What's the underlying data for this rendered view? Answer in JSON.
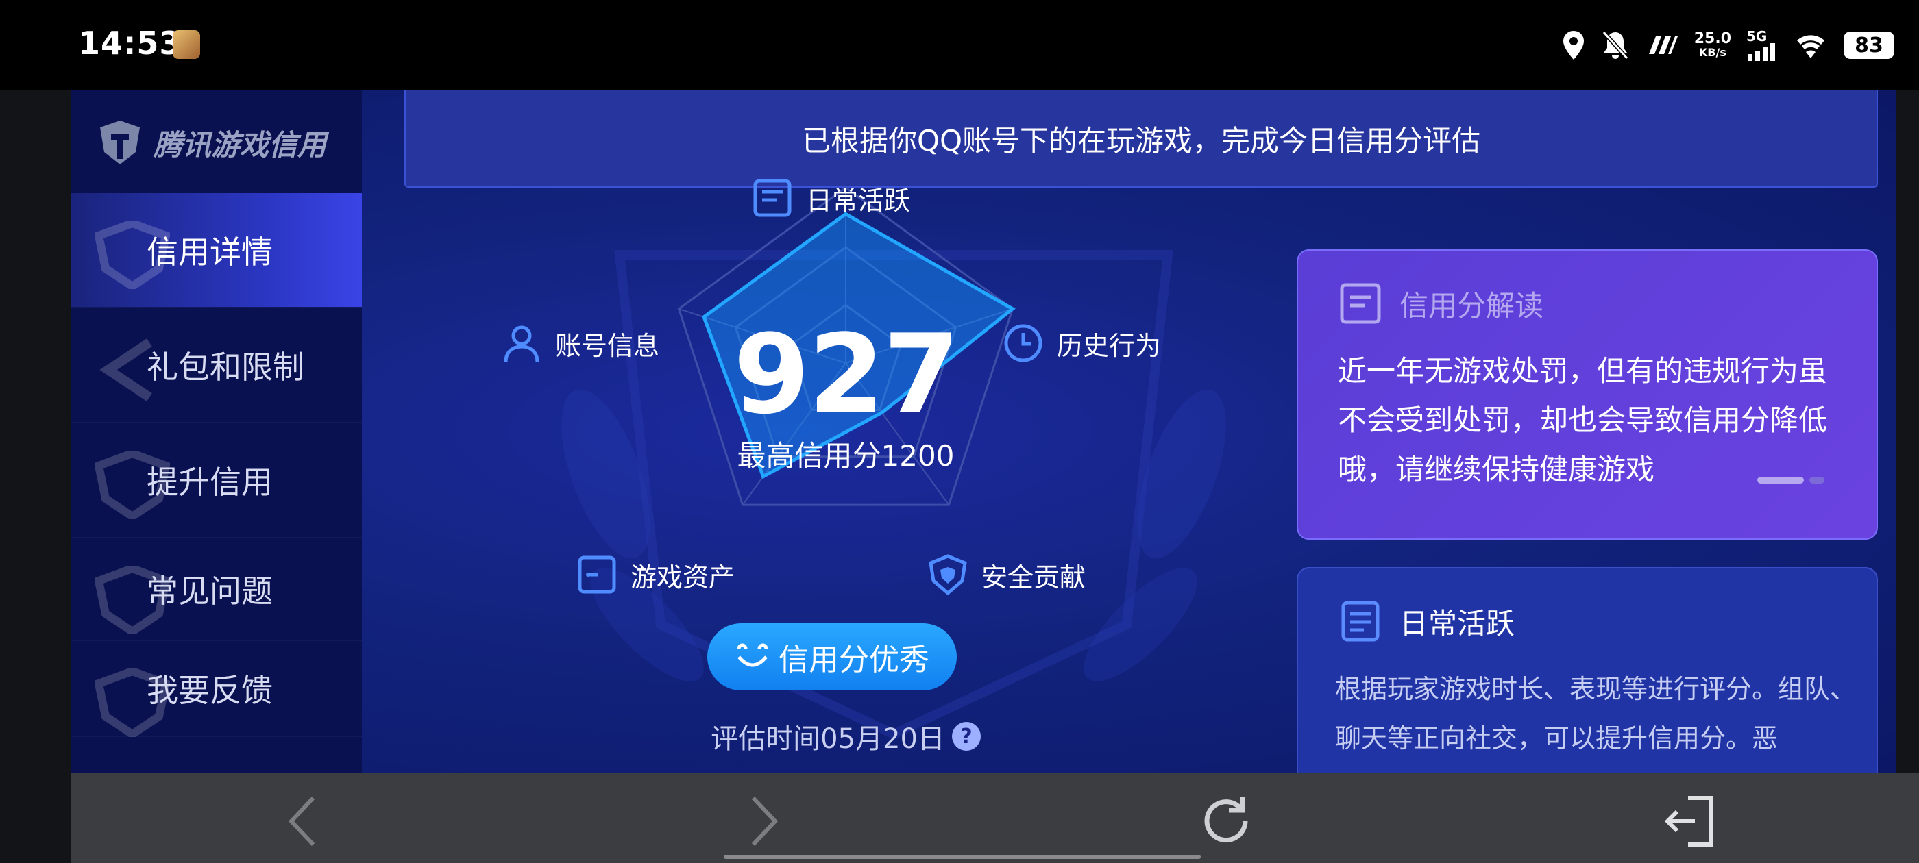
{
  "status_bar": {
    "time": "14:53",
    "net_speed_value": "25.0",
    "net_speed_unit": "KB/s",
    "network": "5G",
    "battery": "83"
  },
  "sidebar": {
    "logo_text": "腾讯游戏信用",
    "items": [
      {
        "label": "信用详情",
        "active": true
      },
      {
        "label": "礼包和限制",
        "active": false
      },
      {
        "label": "提升信用",
        "active": false
      },
      {
        "label": "常见问题",
        "active": false
      },
      {
        "label": "我要反馈",
        "active": false
      }
    ]
  },
  "notice": "已根据你QQ账号下的在玩游戏，完成今日信用分评估",
  "radar": {
    "labels": {
      "daily": "日常活跃",
      "history": "历史行为",
      "account": "账号信息",
      "assets": "游戏资产",
      "security": "安全贡献"
    },
    "levels": {
      "daily": 0.85,
      "history": 1.0,
      "security": 0.35,
      "assets": 0.8,
      "account": 0.85
    },
    "score": "927",
    "max_label": "最高信用分1200",
    "status_button": "信用分优秀",
    "eval_time": "评估时间05月20日",
    "help_glyph": "?"
  },
  "interpret_card": {
    "title": "信用分解读",
    "body": "近一年无游戏处罚，但有的违规行为虽不会受到处罚，却也会导致信用分降低哦，请继续保持健康游戏"
  },
  "daily_card": {
    "title": "日常活跃",
    "body": "根据玩家游戏时长、表现等进行评分。组队、聊天等正向社交，可以提升信用分。恶"
  },
  "colors": {
    "accent_blue": "#1e90ff",
    "card_purple": "#6a42e0",
    "sidebar_bg": "#0a1150",
    "app_bg": "#12237e"
  }
}
